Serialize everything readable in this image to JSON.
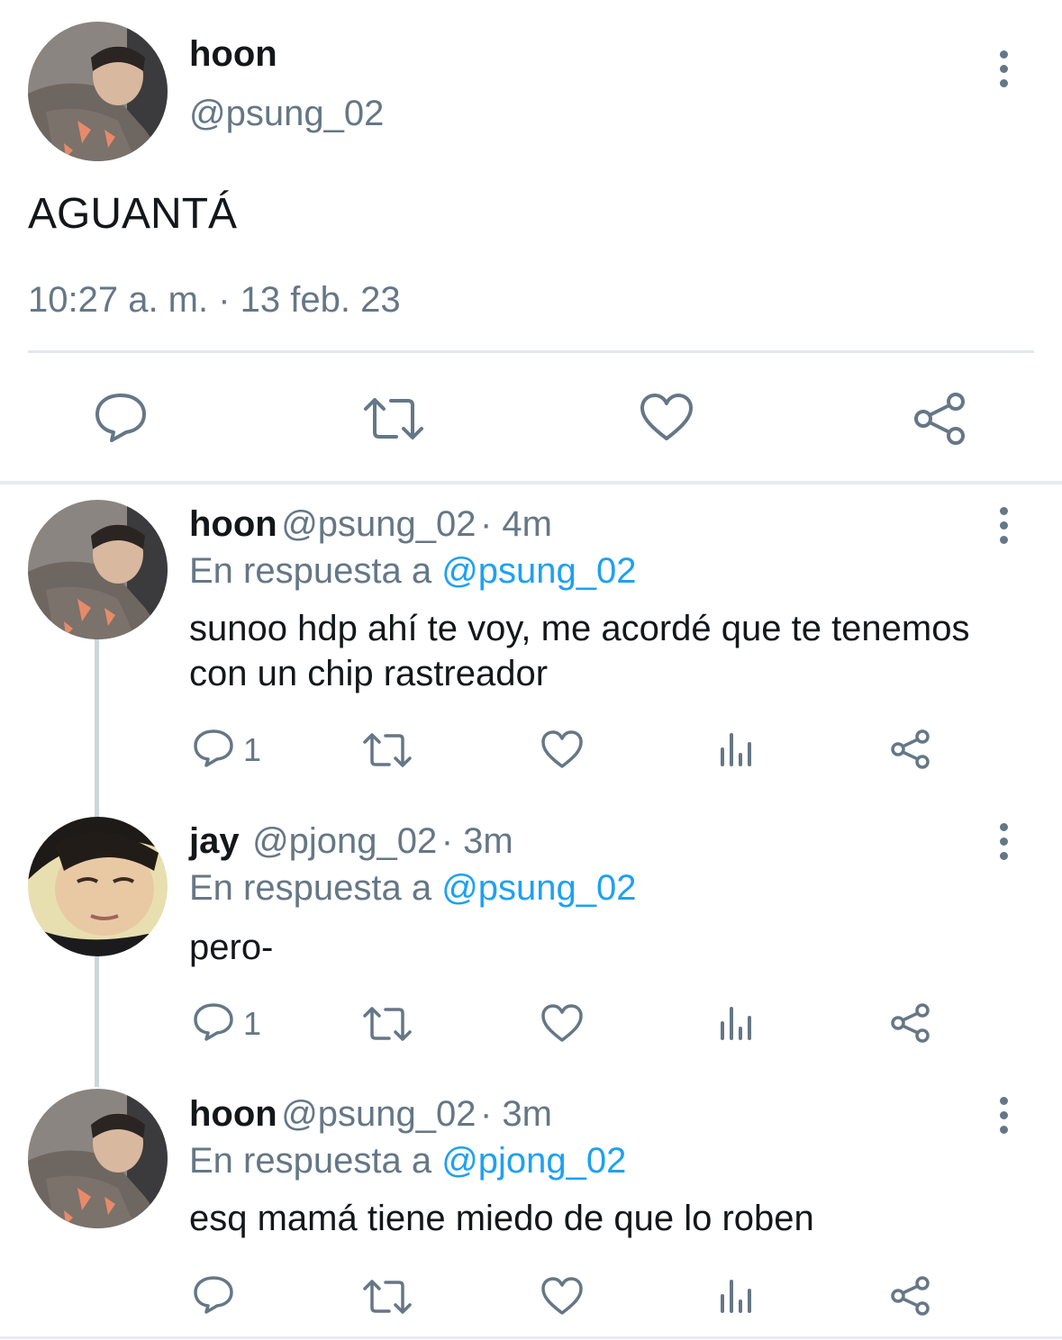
{
  "main_tweet": {
    "name": "hoon",
    "handle": "@psung_02",
    "text": "AGUANTÁ",
    "timestamp": "10:27 a. m. · 13 feb. 23",
    "icons": [
      "reply-icon",
      "retweet-icon",
      "like-icon",
      "share-icon"
    ]
  },
  "replies": [
    {
      "name": "hoon",
      "handle": "@psung_02",
      "time": "· 4m",
      "reply_prefix": "En respuesta a",
      "reply_to": "@psung_02",
      "text_line1": "sunoo hdp ahí te voy, me acordé que te tenemos",
      "text_line2": "con un chip rastreador",
      "reply_count": "1"
    },
    {
      "name": "jay",
      "handle": "@pjong_02",
      "time": "· 3m",
      "reply_prefix": "En respuesta a",
      "reply_to": "@psung_02",
      "text_line1": "pero-",
      "reply_count": "1"
    },
    {
      "name": "hoon",
      "handle": "@psung_02",
      "time": "· 3m",
      "reply_prefix": "En respuesta a",
      "reply_to": "@pjong_02",
      "text_line1": "esq mamá tiene miedo de que lo roben",
      "reply_count": ""
    }
  ],
  "colors": {
    "text": "#14171a",
    "secondary": "#657786",
    "link": "#1da1f2",
    "divider": "#e1e8ed",
    "thread_line": "#ccd6dd"
  }
}
